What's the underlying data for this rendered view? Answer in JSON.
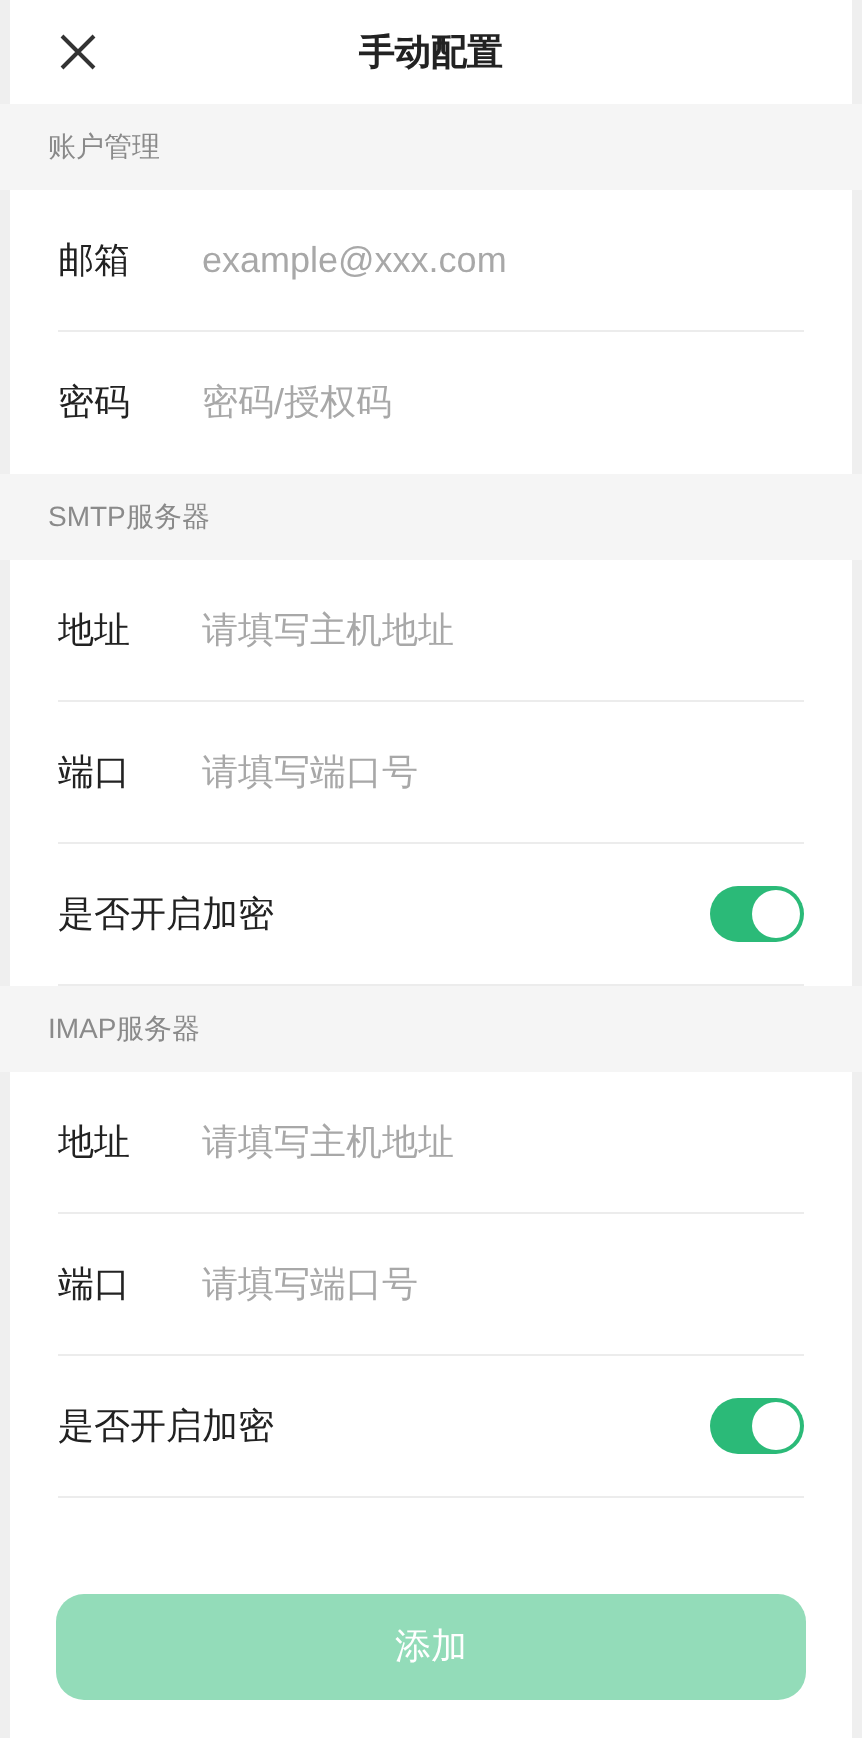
{
  "header": {
    "title": "手动配置"
  },
  "sections": [
    {
      "title": "账户管理",
      "fields": [
        {
          "kind": "input",
          "label": "邮箱",
          "placeholder": "example@xxx.com"
        },
        {
          "kind": "input",
          "label": "密码",
          "placeholder": "密码/授权码"
        }
      ]
    },
    {
      "title": "SMTP服务器",
      "fields": [
        {
          "kind": "input",
          "label": "地址",
          "placeholder": "请填写主机地址"
        },
        {
          "kind": "input",
          "label": "端口",
          "placeholder": "请填写端口号"
        },
        {
          "kind": "toggle",
          "label": "是否开启加密",
          "on": true
        }
      ]
    },
    {
      "title": "IMAP服务器",
      "fields": [
        {
          "kind": "input",
          "label": "地址",
          "placeholder": "请填写主机地址"
        },
        {
          "kind": "input",
          "label": "端口",
          "placeholder": "请填写端口号"
        },
        {
          "kind": "toggle",
          "label": "是否开启加密",
          "on": true
        }
      ]
    }
  ],
  "submit": {
    "label": "添加",
    "disabled": true
  }
}
